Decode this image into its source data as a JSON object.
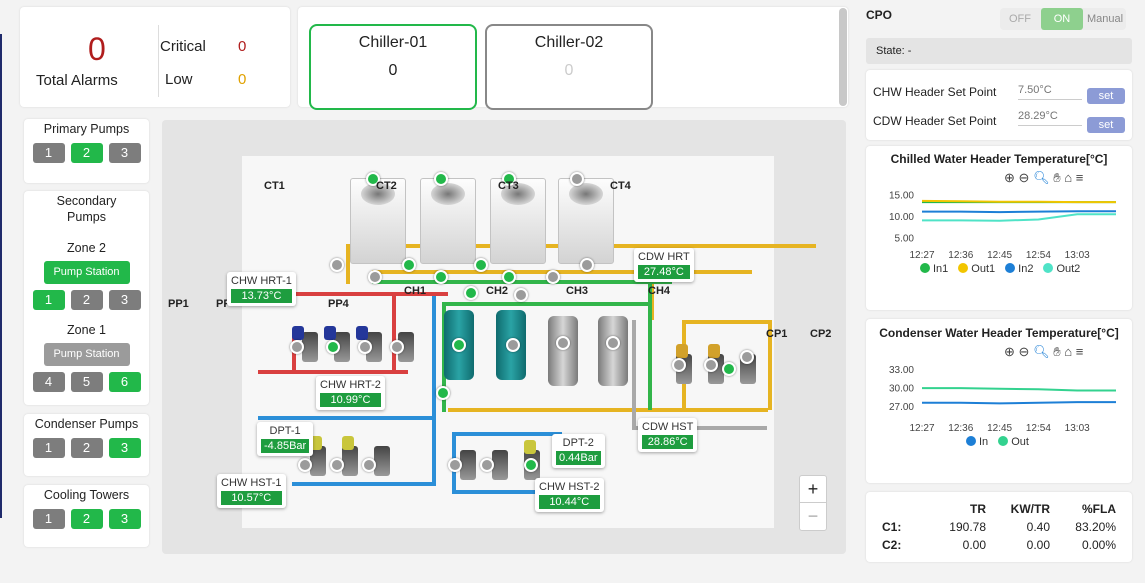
{
  "alarms": {
    "total": "0",
    "total_label": "Total Alarms",
    "critical_label": "Critical",
    "critical": "0",
    "low_label": "Low",
    "low": "0"
  },
  "chillers": [
    {
      "name": "Chiller-01",
      "value": "0"
    },
    {
      "name": "Chiller-02",
      "value": "0"
    }
  ],
  "pumps": {
    "primary": {
      "title": "Primary Pumps",
      "buttons": [
        "1",
        "2",
        "3"
      ]
    },
    "secondary": {
      "title": "Secondary Pumps",
      "zone2": {
        "label": "Zone 2",
        "station": "Pump Station",
        "buttons": [
          "1",
          "2",
          "3"
        ]
      },
      "zone1": {
        "label": "Zone 1",
        "station": "Pump Station",
        "buttons": [
          "4",
          "5",
          "6"
        ]
      }
    },
    "condenser": {
      "title": "Condenser Pumps",
      "buttons": [
        "1",
        "2",
        "3"
      ]
    },
    "towers": {
      "title": "Cooling Towers",
      "buttons": [
        "1",
        "2",
        "3"
      ]
    }
  },
  "diagram": {
    "labels": {
      "ct1": "CT1",
      "ct2": "CT2",
      "ct3": "CT3",
      "ct4": "CT4",
      "ch1": "CH1",
      "ch2": "CH2",
      "ch3": "CH3",
      "ch4": "CH4",
      "pp1": "PP1",
      "pp2": "PP",
      "pp4": "PP4",
      "cp1": "CP1",
      "cp2": "CP2"
    },
    "tags": {
      "chw_hrt1": {
        "name": "CHW HRT-1",
        "value": "13.73°C"
      },
      "chw_hrt2": {
        "name": "CHW HRT-2",
        "value": "10.99°C"
      },
      "cdw_hrt": {
        "name": "CDW HRT",
        "value": "27.48°C"
      },
      "cdw_hst": {
        "name": "CDW HST",
        "value": "28.86°C"
      },
      "dpt1": {
        "name": "DPT-1",
        "value": "-4.85Bar"
      },
      "dpt2": {
        "name": "DPT-2",
        "value": "0.44Bar"
      },
      "chw_hst1": {
        "name": "CHW HST-1",
        "value": "10.57°C"
      },
      "chw_hst2": {
        "name": "CHW HST-2",
        "value": "10.44°C"
      }
    },
    "zoom_in": "+",
    "zoom_out": "−"
  },
  "cpo": {
    "title": "CPO",
    "off": "OFF",
    "on": "ON",
    "manual": "Manual",
    "state": "State: -"
  },
  "setpoints": [
    {
      "label": "CHW Header Set Point",
      "placeholder": "7.50°C",
      "button": "set"
    },
    {
      "label": "CDW Header Set Point",
      "placeholder": "28.29°C",
      "button": "set"
    }
  ],
  "colors": {
    "green": "#22b84a",
    "gray": "#7d7d7d",
    "alarm_red": "#b01d1d",
    "low_amber": "#e0a100",
    "set_button": "#8c9bd6"
  },
  "chart_data": [
    {
      "type": "line",
      "title": "Chilled Water Header Temperature[°C]",
      "x": [
        "12:27",
        "12:36",
        "12:45",
        "12:54",
        "13:03"
      ],
      "yticks": [
        5,
        10,
        15
      ],
      "ylim": [
        4,
        16
      ],
      "series": [
        {
          "name": "In1",
          "color": "#22b84a",
          "values": [
            13.2,
            13.2,
            13.2,
            13.2,
            13.2
          ]
        },
        {
          "name": "Out1",
          "color": "#f2c500",
          "values": [
            13.5,
            13.4,
            13.3,
            13.3,
            13.2
          ]
        },
        {
          "name": "In2",
          "color": "#1d7fd6",
          "values": [
            11.0,
            11.0,
            10.9,
            11.0,
            11.1
          ]
        },
        {
          "name": "Out2",
          "color": "#4fe3c7",
          "values": [
            9.0,
            9.0,
            8.9,
            9.2,
            10.4
          ]
        }
      ],
      "legend": "bottom"
    },
    {
      "type": "line",
      "title": "Condenser Water Header Temperature[°C]",
      "x": [
        "12:27",
        "12:36",
        "12:45",
        "12:54",
        "13:03"
      ],
      "yticks": [
        27,
        30,
        33
      ],
      "ylim": [
        25.5,
        34
      ],
      "series": [
        {
          "name": "In",
          "color": "#1d7fd6",
          "values": [
            27.5,
            27.5,
            27.4,
            27.5,
            27.6
          ]
        },
        {
          "name": "Out",
          "color": "#33d28f",
          "values": [
            29.9,
            29.9,
            29.8,
            29.7,
            29.5
          ]
        }
      ],
      "legend": "bottom"
    }
  ],
  "performance": {
    "headers": [
      "TR",
      "KW/TR",
      "%FLA"
    ],
    "rows": [
      {
        "label": "C1:",
        "values": [
          "190.78",
          "0.40",
          "83.20%"
        ]
      },
      {
        "label": "C2:",
        "values": [
          "0.00",
          "0.00",
          "0.00%"
        ]
      }
    ]
  }
}
